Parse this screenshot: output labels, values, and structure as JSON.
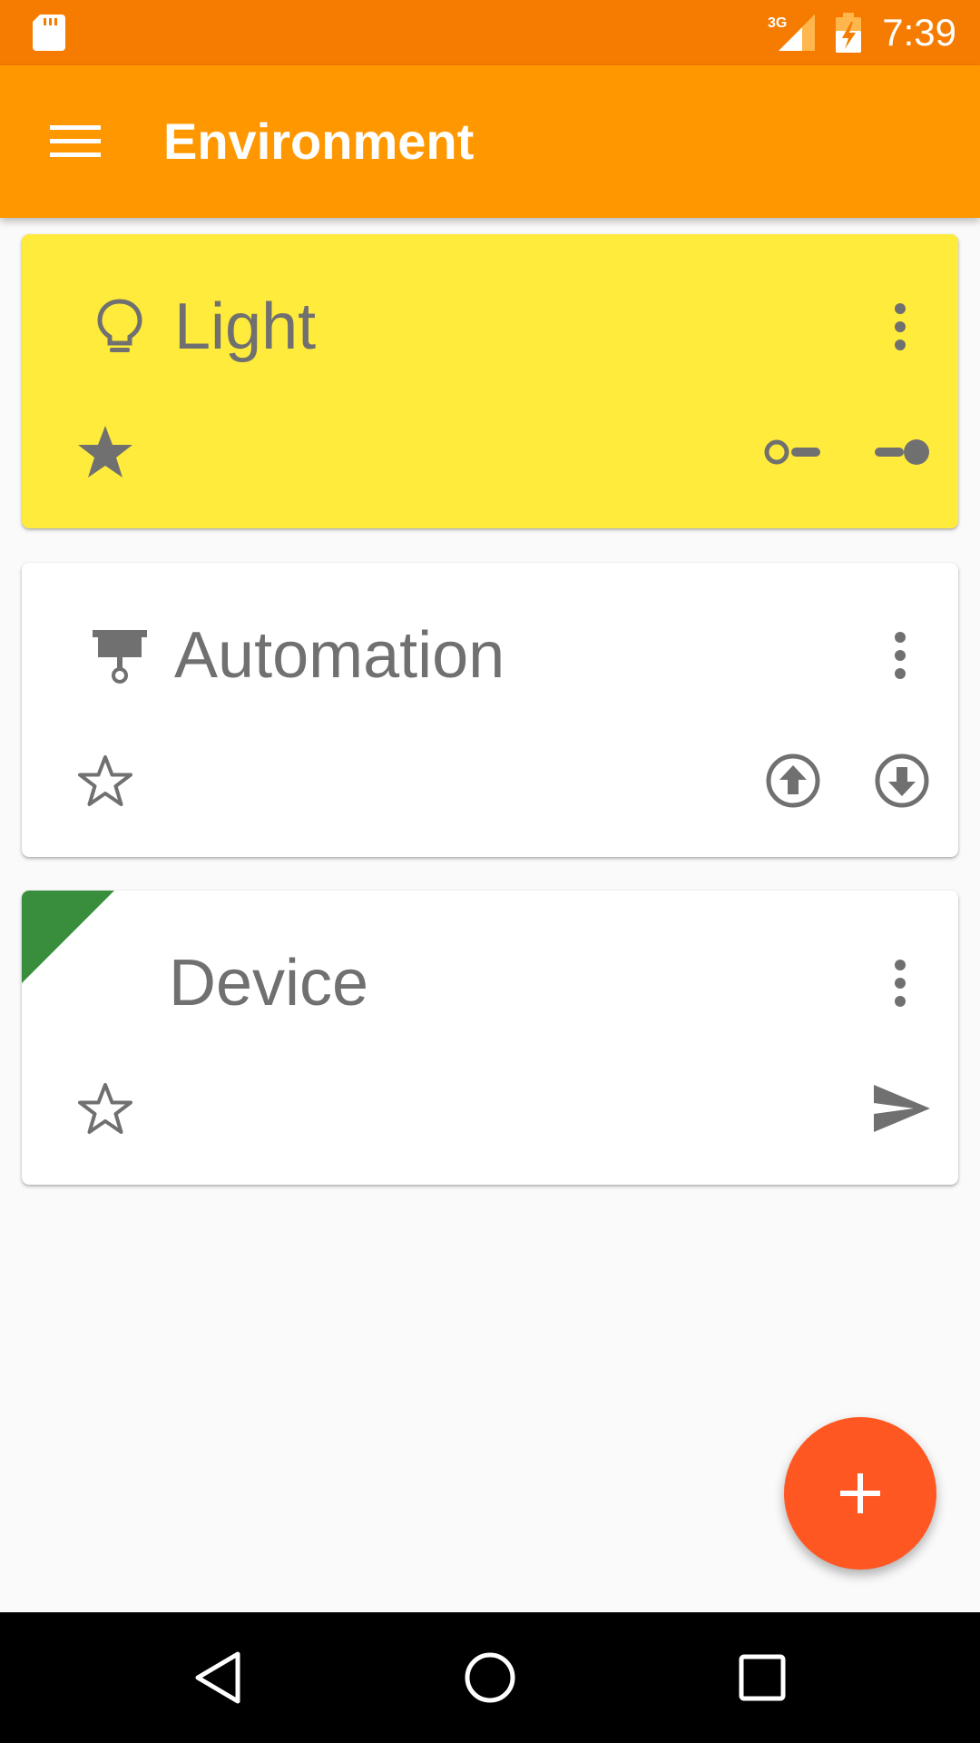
{
  "status_bar": {
    "time": "7:39",
    "network_label": "3G",
    "icons": [
      "sd-card-icon",
      "signal-icon",
      "battery-charging-icon"
    ]
  },
  "app_bar": {
    "title": "Environment",
    "menu_icon": "hamburger-menu-icon"
  },
  "cards": [
    {
      "title": "Light",
      "background": "#FFEB3B",
      "type_icon": "lightbulb-icon",
      "favorite": true,
      "actions": [
        "toggle-off-icon",
        "toggle-on-icon"
      ]
    },
    {
      "title": "Automation",
      "background": "#FFFFFF",
      "type_icon": "projector-screen-icon",
      "favorite": false,
      "actions": [
        "arrow-up-circle-icon",
        "arrow-down-circle-icon"
      ]
    },
    {
      "title": "Device",
      "background": "#FFFFFF",
      "type_icon": null,
      "corner_flag_color": "#388E3C",
      "favorite": false,
      "actions": [
        "send-icon"
      ]
    }
  ],
  "fab": {
    "icon": "plus-icon",
    "color": "#FF5722"
  },
  "navigation_bar": {
    "buttons": [
      "back-icon",
      "home-icon",
      "recents-icon"
    ]
  },
  "colors": {
    "status_bar": "#F57C00",
    "app_bar": "#FF9800",
    "icon_gray": "#707070",
    "background": "#FAFAFA"
  }
}
